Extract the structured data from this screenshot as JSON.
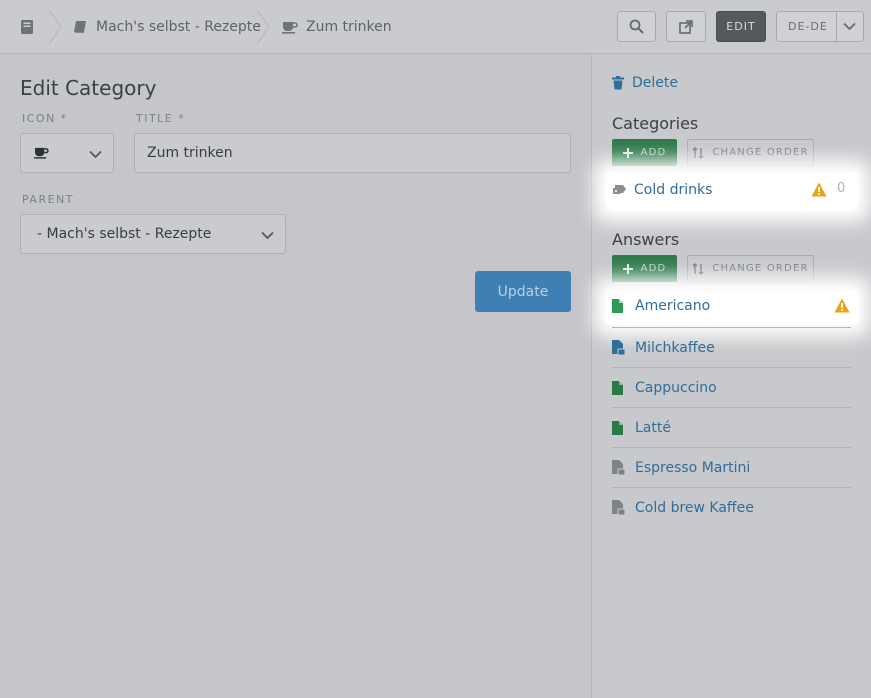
{
  "topbar": {
    "crumbs": [
      "Mach's selbst - Rezepte",
      "Zum trinken"
    ],
    "edit_label": "EDIT",
    "locale_label": "DE-DE"
  },
  "form": {
    "title": "Edit Category",
    "icon_label": "ICON *",
    "title_label": "TITLE *",
    "title_value": "Zum trinken",
    "parent_label": "PARENT",
    "parent_value": "- Mach's selbst - Rezepte",
    "update_label": "Update"
  },
  "sidebar": {
    "delete_label": "Delete",
    "categories_title": "Categories",
    "add_label": "ADD",
    "change_order_label": "CHANGE ORDER",
    "categories": [
      {
        "label": "Cold drinks",
        "warning": true,
        "count": "0"
      }
    ],
    "answers_title": "Answers",
    "answers": [
      {
        "label": "Americano",
        "icon": "file-green-icon",
        "warning": true
      },
      {
        "label": "Milchkaffee",
        "icon": "file-lock-blue-icon",
        "warning": false
      },
      {
        "label": "Cappuccino",
        "icon": "file-green-icon",
        "warning": false
      },
      {
        "label": "Latté",
        "icon": "file-green-icon",
        "warning": false
      },
      {
        "label": "Espresso Martini",
        "icon": "file-grey-icon",
        "warning": false
      },
      {
        "label": "Cold brew Kaffee",
        "icon": "file-grey-icon",
        "warning": false
      }
    ]
  },
  "colors": {
    "accent_blue": "#2f6d9a",
    "add_green": "#2f7a4c",
    "warning": "#e8a317"
  }
}
